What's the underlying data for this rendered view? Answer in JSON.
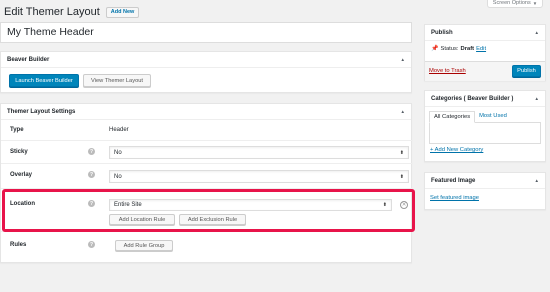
{
  "screen_options": {
    "label": "Screen Options"
  },
  "header": {
    "title": "Edit Themer Layout",
    "add_new": "Add New"
  },
  "post_title": "My Theme Header",
  "beaver_builder": {
    "heading": "Beaver Builder",
    "launch": "Launch Beaver Builder",
    "view": "View Themer Layout"
  },
  "settings": {
    "heading": "Themer Layout Settings",
    "type": {
      "label": "Type",
      "value": "Header"
    },
    "sticky": {
      "label": "Sticky",
      "value": "No"
    },
    "overlay": {
      "label": "Overlay",
      "value": "No"
    },
    "location": {
      "label": "Location",
      "value": "Entire Site",
      "add_location": "Add Location Rule",
      "add_exclusion": "Add Exclusion Rule"
    },
    "rules": {
      "label": "Rules",
      "add_group": "Add Rule Group"
    }
  },
  "publish": {
    "heading": "Publish",
    "status_label": "Status:",
    "status_value": "Draft",
    "edit": "Edit",
    "trash": "Move to Trash",
    "publish_button": "Publish"
  },
  "categories": {
    "heading": "Categories ( Beaver Builder )",
    "tab_all": "All Categories",
    "tab_most": "Most Used",
    "add_new": "+ Add New Category"
  },
  "featured": {
    "heading": "Featured Image",
    "set_link": "Set featured image"
  },
  "colors": {
    "highlight": "#e8144a",
    "primary": "#0085ba",
    "link": "#0073aa",
    "trash": "#a00000"
  }
}
